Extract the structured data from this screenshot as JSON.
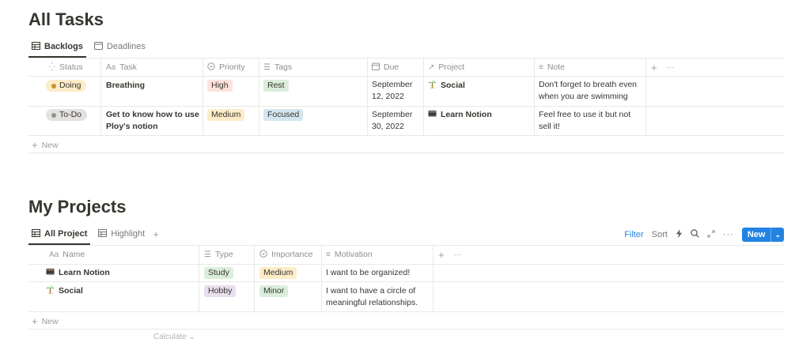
{
  "tasks": {
    "title": "All Tasks",
    "tabs": [
      {
        "label": "Backlogs",
        "icon": "table-icon",
        "active": true
      },
      {
        "label": "Deadlines",
        "icon": "calendar-icon",
        "active": false
      }
    ],
    "columns": {
      "status": "Status",
      "task": "Task",
      "priority": "Priority",
      "tags": "Tags",
      "due": "Due",
      "project": "Project",
      "note": "Note"
    },
    "rows": [
      {
        "status": "Doing",
        "task": "Breathing",
        "priority": "High",
        "tag": "Rest",
        "due_line1": "September",
        "due_line2": "12, 2022",
        "project": "Social",
        "note_line1": "Don't forget to breath even",
        "note_line2": "when you are swimming"
      },
      {
        "status": "To-Do",
        "task_line1": "Get to know how to use",
        "task_line2": "Ploy's notion",
        "priority": "Medium",
        "tag": "Focused",
        "due_line1": "September",
        "due_line2": "30, 2022",
        "project": "Learn Notion",
        "note_line1": "Feel free to use it but not",
        "note_line2": "sell it!"
      }
    ],
    "new_label": "New"
  },
  "projects": {
    "title": "My Projects",
    "tabs": [
      {
        "label": "All Project",
        "icon": "table-icon",
        "active": true
      },
      {
        "label": "Highlight",
        "icon": "table-icon",
        "active": false
      }
    ],
    "columns": {
      "name": "Name",
      "type": "Type",
      "importance": "Importance",
      "motivation": "Motivation"
    },
    "rows": [
      {
        "name": "Learn Notion",
        "type": "Study",
        "importance": "Medium",
        "motivation_line1": "I want to be organized!",
        "motivation_line2": ""
      },
      {
        "name": "Social",
        "type": "Hobby",
        "importance": "Minor",
        "motivation_line1": "I want to have a circle of",
        "motivation_line2": "meaningful relationships."
      }
    ],
    "new_label": "New",
    "calculate_label": "Calculate"
  },
  "toolbar": {
    "filter": "Filter",
    "sort": "Sort",
    "new_button": "New"
  },
  "colors": {
    "accent_blue": "#2383e2",
    "doing_bg": "#fdecc8",
    "doing_dot": "#cb912f",
    "todo_bg": "#e3e2e0",
    "todo_dot": "#91918e",
    "high_bg": "#ffe2dd",
    "medium_bg": "#fdecc8",
    "minor_bg": "#dbeddb",
    "rest_bg": "#dbeddb",
    "focused_bg": "#d3e5ef",
    "study_bg": "#dbeddb",
    "hobby_bg": "#e8deee"
  }
}
